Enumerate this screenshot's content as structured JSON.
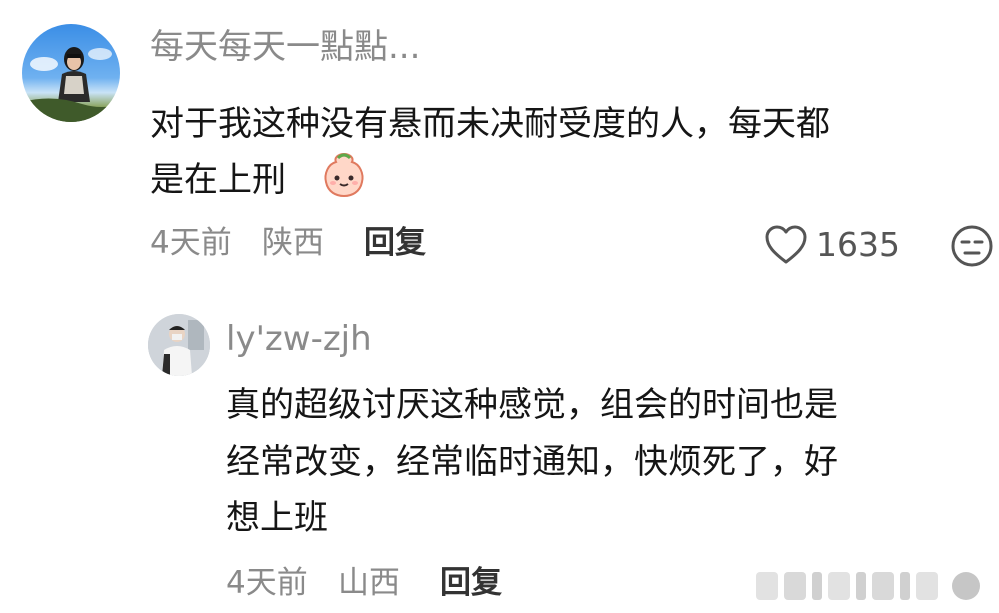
{
  "comment1": {
    "username": "每天每天一點點...",
    "text_line1": "对于我这种没有悬而未决耐受度的人，每天都",
    "text_line2": "是在上刑",
    "emoji": "smiling-face-emoji",
    "time": "4天前",
    "location": "陕西",
    "reply_label": "回复",
    "like_count": "1635"
  },
  "comment2": {
    "username": "ly'zw-zjh",
    "text_line1": "真的超级讨厌这种感觉，组会的时间也是",
    "text_line2": "经常改变，经常临时通知，快烦死了，好",
    "text_line3": "想上班",
    "time": "4天前",
    "location": "山西",
    "reply_label": "回复"
  },
  "icons": {
    "like": "heart-outline-icon",
    "dislike": "unamused-face-icon",
    "watermark": "weibo-watermark"
  },
  "colors": {
    "username": "#8a8a8a",
    "body_text": "#151515",
    "meta": "#8a8a8a"
  }
}
